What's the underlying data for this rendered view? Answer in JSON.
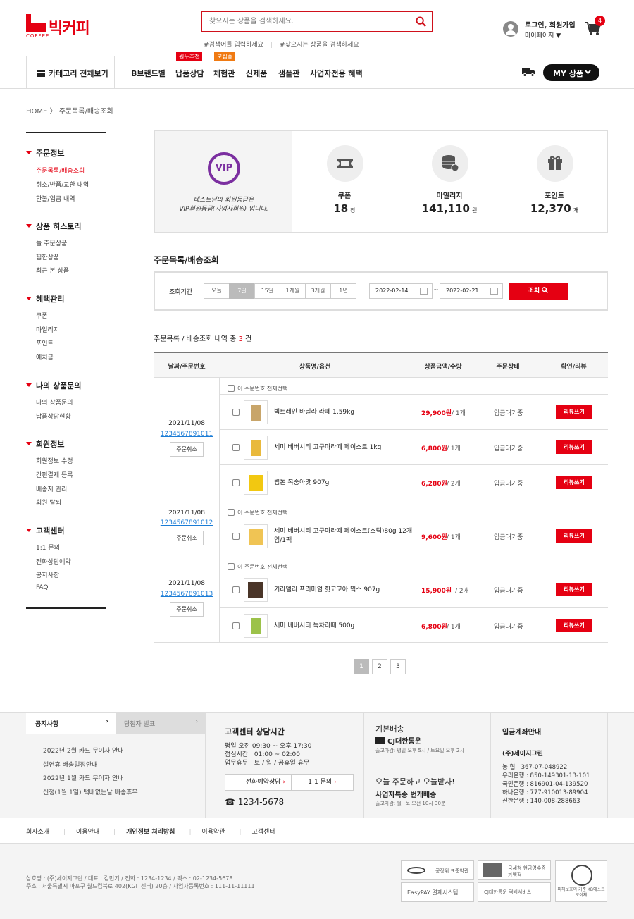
{
  "header": {
    "logo": "빅커피",
    "logo_sub": "COFFEE",
    "search_placeholder": "찾으시는 상품을 검색하세요.",
    "hashtags": [
      "#검색어를 입력하세요",
      "#찾으시는 상품을 검색하세요"
    ],
    "login": "로그인, 회원가입",
    "mypage": "마이페이지 ▼",
    "cart_count": "4"
  },
  "nav": {
    "category_all": "카테고리 전체보기",
    "items": [
      "B브랜드별",
      "납품상담",
      "체험관",
      "신제품",
      "샘플관",
      "사업자전용 혜택"
    ],
    "tag_nabpum": "원두추천",
    "tag_chehum": "모집중",
    "my_products": "MY 상품"
  },
  "breadcrumb": "HOME 〉 주문목록/배송조회",
  "sidebar": {
    "groups": [
      {
        "title": "주문정보",
        "items": [
          "주문목록/배송조회",
          "취소/반품/교환 내역",
          "환불/입금 내역"
        ]
      },
      {
        "title": "상품 히스토리",
        "items": [
          "늘 주문상품",
          "찜한상품",
          "최근 본 상품"
        ]
      },
      {
        "title": "혜택관리",
        "items": [
          "쿠폰",
          "마일리지",
          "포인트",
          "예치금"
        ]
      },
      {
        "title": "나의 상품문의",
        "items": [
          "나의 상품문의",
          "납품상담현황"
        ]
      },
      {
        "title": "회원정보",
        "items": [
          "회원정보 수정",
          "간편결제 등록",
          "배송지 관리",
          "회원 탈퇴"
        ]
      },
      {
        "title": "고객센터",
        "items": [
          "1:1 문의",
          "전화상담예약",
          "공지사항",
          "FAQ"
        ]
      }
    ]
  },
  "summary": {
    "vip_badge": "VIP",
    "grade_line1": "테스트님의 회원등급은",
    "grade_line2": "VIP회원등급(사업자회원) 입니다.",
    "coupon_label": "쿠폰",
    "coupon_value": "18",
    "coupon_unit": "장",
    "mileage_label": "마일리지",
    "mileage_value": "141,110",
    "mileage_unit": "원",
    "point_label": "포인트",
    "point_value": "12,370",
    "point_unit": "개"
  },
  "orders_section": {
    "title": "주문목록/배송조회",
    "period_label": "조회기간",
    "periods": [
      "오늘",
      "7일",
      "15일",
      "1개월",
      "3개월",
      "1년"
    ],
    "active_period": "7일",
    "date_from": "2022-02-14",
    "date_to": "2022-02-21",
    "tilde": "~",
    "search_btn": "조회",
    "count_prefix": "주문목록 / 배송조회 내역 총",
    "count": "3",
    "count_suffix": "건"
  },
  "table": {
    "headers": [
      "날짜/주문번호",
      "상품명/옵션",
      "상품금액/수량",
      "주문상태",
      "확인/리뷰"
    ],
    "select_all": "이 주문번호 전체선택",
    "cancel": "주문취소",
    "review": "리뷰쓰기",
    "groups": [
      {
        "date": "2021/11/08",
        "order_no": "1234567891011",
        "items": [
          {
            "name": "빅트레인 바닐라 라떼 1.59kg",
            "price": "29,900원",
            "qty": "/ 1개",
            "status": "입금대기중"
          },
          {
            "name": "세미 베버시티 고구마라떼 페이스트 1kg",
            "price": "6,800원",
            "qty": "/ 1개",
            "status": "입금대기중"
          },
          {
            "name": "립톤 복숭아맛 907g",
            "price": "6,280원",
            "qty": "/ 2개",
            "status": "입금대기중"
          }
        ]
      },
      {
        "date": "2021/11/08",
        "order_no": "1234567891012",
        "items": [
          {
            "name": "세미 베버시티 고구마라떼 페이스트(스틱)80g 12개입/1팩",
            "price": "9,600원",
            "qty": "/ 1개",
            "status": "입금대기중"
          }
        ]
      },
      {
        "date": "2021/11/08",
        "order_no": "1234567891013",
        "items": [
          {
            "name": "기라델리 프리미엄 핫코코아 믹스 907g",
            "price": "15,900원",
            "qty": "/ 2개",
            "status": "입금대기중"
          },
          {
            "name": "세미 베버시티 녹차라떼 500g",
            "price": "6,800원",
            "qty": "/ 1개",
            "status": "입금대기중"
          }
        ]
      }
    ]
  },
  "pager": [
    "1",
    "2",
    "3"
  ],
  "footer": {
    "tab_notice": "공지사항",
    "tab_winner": "당첨자 발표",
    "notices": [
      "2022년 2월 카드 무이자 안내",
      "설연휴 배송일정안내",
      "2022년 1월 카드 무이자 안내",
      "신정(1월 1일) 택배없는날 배송휴무"
    ],
    "cs_title": "고객센터 상담시간",
    "cs_lines": [
      "평일 오전 09:30 ~ 오후 17:30",
      "점심시간 : 01:00 ~ 02:00",
      "업무휴무 : 토 / 일 / 공휴일 휴무"
    ],
    "cs_btn1": "전화예약상담",
    "cs_btn2": "1:1 문의",
    "cs_phone": "☎ 1234-5678",
    "ship_title": "기본배송",
    "ship_company": "CJ대한통운",
    "ship_time": "출고마감: 평일 오후 5시 / 토요일 오후 2시",
    "today_title": "오늘 주문하고 오늘받자!",
    "today_sub": "사업자특송 번개배송",
    "today_time": "출고마감: 월~토 오전 10시 30분",
    "bank_title": "입금계좌안내",
    "bank_owner": "(주)세이지그린",
    "banks": [
      "농      협 : 367-07-048922",
      "우리은행 : 850-149301-13-101",
      "국민은행 : 816901-04-139520",
      "하나은행 : 777-910013-89904",
      "신한은행 : 140-008-288663"
    ],
    "links": [
      "회사소개",
      "이용안내",
      "개인정보 처리방침",
      "이용약관",
      "고객센터"
    ],
    "corp1": "상호명 : (주)세이지그린 / 대표 : 김민기 / 전화 : 1234-1234 / 팩스 : 02-1234-5678",
    "corp2": "주소 : 서울특별시 마포구 월드컵북로 402(KGIT센터) 20층 / 사업자등록번호 : 111-11-11111",
    "badges": [
      "공정위 표준약관",
      "국세청 현금영수증 가맹점",
      "EasyPAY 결제시스템",
      "CJ대한통운 택배서비스",
      "피해보호의 기준 KB에스크로이체"
    ]
  }
}
